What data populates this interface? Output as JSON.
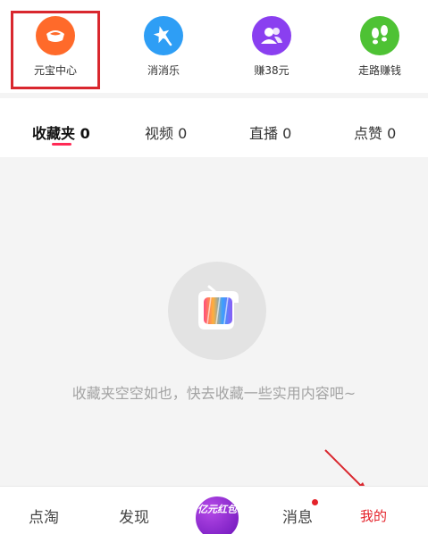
{
  "quick_icons": [
    {
      "label": "元宝中心",
      "icon": "ingot-icon",
      "color": "#ff6a2a"
    },
    {
      "label": "消消乐",
      "icon": "star-wand-icon",
      "color": "#2e9ef5"
    },
    {
      "label": "赚38元",
      "icon": "users-icon",
      "color": "#8a3ff0"
    },
    {
      "label": "走路赚钱",
      "icon": "footprints-icon",
      "color": "#4ec234"
    }
  ],
  "tabs": [
    {
      "label": "收藏夹 0",
      "active": true
    },
    {
      "label": "视频 0",
      "active": false
    },
    {
      "label": "直播 0",
      "active": false
    },
    {
      "label": "点赞 0",
      "active": false
    }
  ],
  "empty_state": {
    "message": "收藏夹空空如也，快去收藏一些实用内容吧~",
    "icon": "tv-logo-icon"
  },
  "bottom_nav": {
    "items": [
      {
        "label": "点淘"
      },
      {
        "label": "发现"
      },
      {
        "label": "消息",
        "has_badge": true
      },
      {
        "label": "我的",
        "active": true
      }
    ],
    "center_button_text": "亿元红包"
  },
  "colors": {
    "accent": "#e4222a",
    "tab_underline": "#ff2a55",
    "annotation_red": "#d9272e"
  }
}
